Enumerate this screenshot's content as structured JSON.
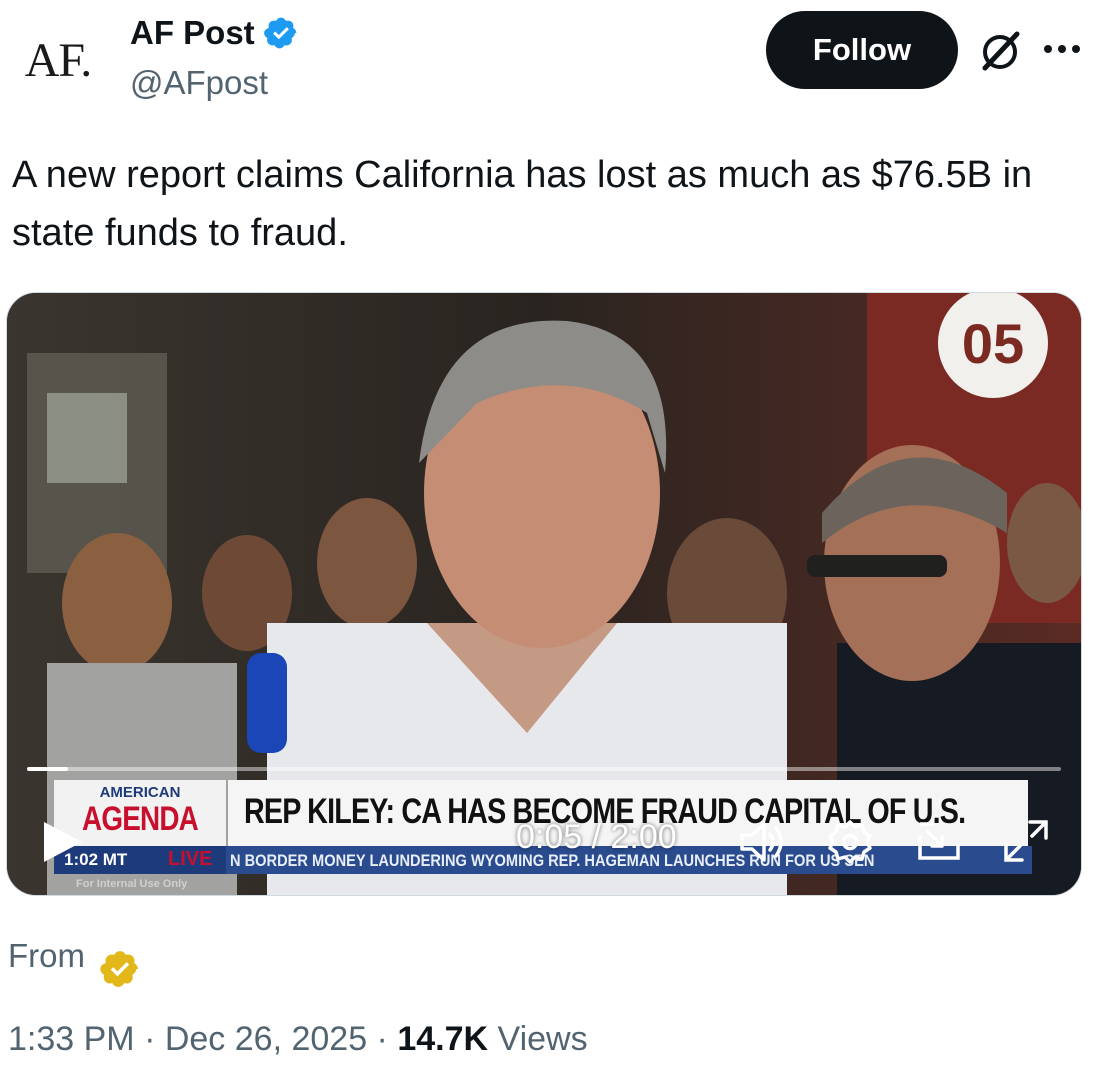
{
  "author": {
    "avatar_text": "AF.",
    "display_name": "AF Post",
    "handle": "@AFpost",
    "verified_color": "#1d9bf0"
  },
  "actions": {
    "follow_label": "Follow"
  },
  "tweet": {
    "text": "A new report claims California has lost as much as $76.5B in state funds to fraud."
  },
  "video": {
    "chyron": {
      "brand_top": "AMERICAN",
      "brand_main": "AGENDA",
      "headline": "REP KILEY: CA HAS BECOME FRAUD CAPITAL OF U.S.",
      "time": "1:02 MT",
      "live": "LIVE",
      "ticker": "N BORDER MONEY LAUNDERING     WYOMING REP. HAGEMAN LAUNCHES RUN FOR US SEN",
      "footer_note": "For Internal Use Only"
    },
    "sign_number": "05",
    "player": {
      "current_time": "0:05",
      "duration": "2:00",
      "time_readout": "0:05 / 2:00",
      "progress_fraction": 0.04
    }
  },
  "source": {
    "from_label": "From",
    "badge_color": "#e2b719"
  },
  "meta": {
    "time": "1:33 PM",
    "separator": " · ",
    "date": "Dec 26, 2025",
    "views_count": "14.7K",
    "views_label": "Views"
  }
}
